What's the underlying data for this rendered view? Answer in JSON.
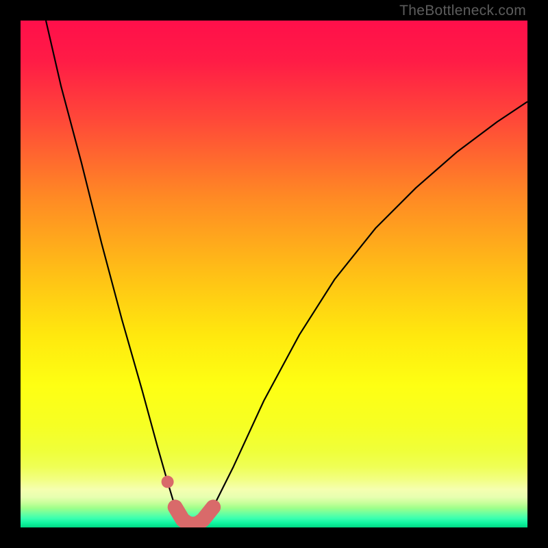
{
  "watermark": "TheBottleneck.com",
  "chart_data": {
    "type": "line",
    "title": "",
    "xlabel": "",
    "ylabel": "",
    "xlim": [
      0,
      100
    ],
    "ylim": [
      0,
      100
    ],
    "series": [
      {
        "name": "bottleneck-curve",
        "x": [
          5,
          8,
          12,
          16,
          20,
          24,
          27,
          29,
          30.5,
          32,
          33,
          34,
          35,
          36,
          38,
          42,
          48,
          55,
          62,
          70,
          78,
          86,
          94,
          100
        ],
        "y": [
          100,
          87,
          72,
          56,
          41,
          27,
          16,
          9,
          4,
          1.5,
          0.8,
          0.6,
          0.8,
          1.5,
          4,
          12,
          25,
          38,
          49,
          59,
          67,
          74,
          80,
          84
        ]
      }
    ],
    "highlight": {
      "name": "low-bottleneck-region",
      "x": [
        29,
        30.5,
        32,
        33,
        34,
        35,
        36,
        38
      ],
      "y": [
        9,
        4,
        1.5,
        0.8,
        0.6,
        0.8,
        1.5,
        4
      ]
    },
    "background_bands": [
      {
        "color": "#ff1a49",
        "y": 100
      },
      {
        "color": "#ff5838",
        "y": 75
      },
      {
        "color": "#ffa51e",
        "y": 55
      },
      {
        "color": "#ffe40f",
        "y": 35
      },
      {
        "color": "#f3ff15",
        "y": 20
      },
      {
        "color": "#e0ff3a",
        "y": 12
      },
      {
        "color": "#b7ff5a",
        "y": 8
      },
      {
        "color": "#7cff7a",
        "y": 5
      },
      {
        "color": "#2fff95",
        "y": 2
      },
      {
        "color": "#00e58c",
        "y": 0
      }
    ]
  }
}
